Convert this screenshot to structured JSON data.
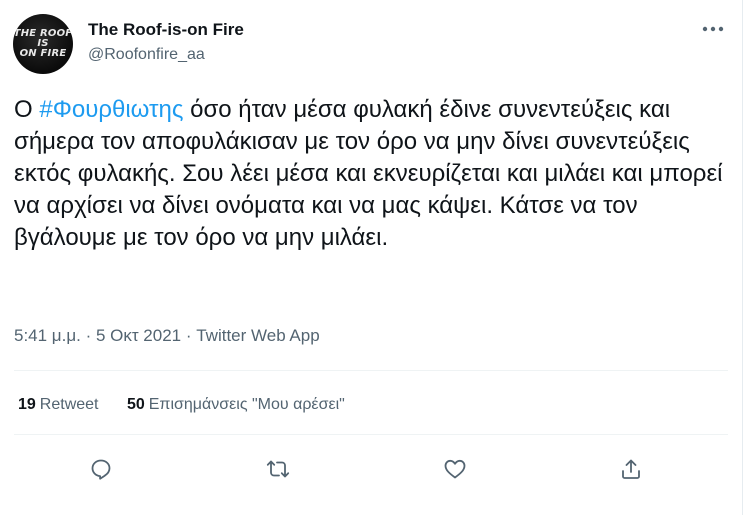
{
  "author": {
    "display_name": "The Roof-is-on Fire",
    "handle": "@Roofonfire_aa",
    "avatar_logo_lines": [
      "THE ROOF",
      "IS",
      "ON FIRE"
    ]
  },
  "more_icon": "more-horizontal-icon",
  "tweet": {
    "hashtag_prefix": "Ο ",
    "hashtag": "#Φουρθιωτης",
    "text": " όσο ήταν μέσα φυλακή έδινε συνεντεύξεις και σήμερα τον αποφυλάκισαν με τον όρο να μην δίνει συνεντεύξεις εκτός φυλακής. Σου λέει μέσα και εκνευρίζεται και μιλάει και μπορεί να αρχίσει να δίνει ονόματα και να μας κάψει. Κάτσε να τον βγάλουμε με τον όρο να μην μιλάει."
  },
  "meta": {
    "time_date": "5:41 μ.μ. · 5 Οκτ 2021 · ",
    "source": "Twitter Web App"
  },
  "stats": {
    "retweets_count": "19",
    "retweets_label": "Retweet",
    "likes_count": "50",
    "likes_label": "Επισημάνσεις \"Μου αρέσει\""
  },
  "actions": [
    "reply-icon",
    "retweet-icon",
    "like-icon",
    "share-icon"
  ],
  "colors": {
    "hashtag": "#1d9bf0",
    "secondary_text": "#536471",
    "primary_text": "#0f1419",
    "divider": "#eff3f4"
  }
}
